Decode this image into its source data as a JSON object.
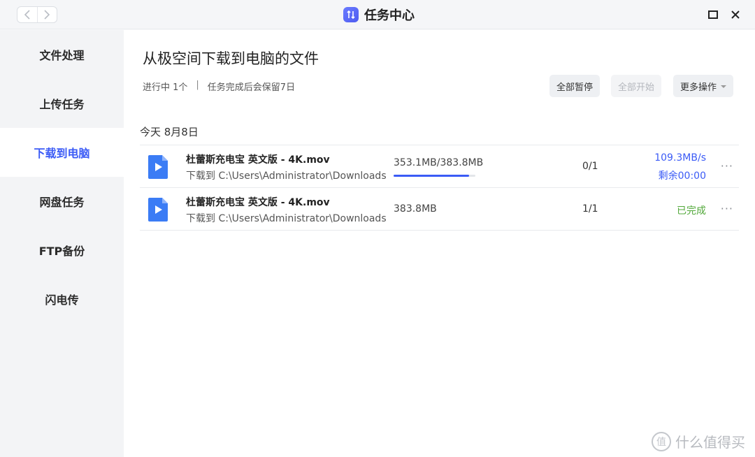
{
  "window": {
    "title": "任务中心",
    "nav_back_icon": "chevron-left-icon",
    "nav_forward_icon": "chevron-right-icon",
    "maximize_icon": "maximize-icon",
    "close_icon": "close-icon"
  },
  "sidebar": {
    "items": [
      {
        "label": "文件处理",
        "active": false
      },
      {
        "label": "上传任务",
        "active": false
      },
      {
        "label": "下载到电脑",
        "active": true
      },
      {
        "label": "网盘任务",
        "active": false
      },
      {
        "label": "FTP备份",
        "active": false
      },
      {
        "label": "闪电传",
        "active": false
      }
    ]
  },
  "main": {
    "title": "从极空间下载到电脑的文件",
    "in_progress": "进行中 1个",
    "separator": "|",
    "retention": "任务完成后会保留7日",
    "buttons": {
      "pause_all": "全部暂停",
      "start_all": "全部开始",
      "more_actions": "更多操作"
    },
    "date_header": "今天 8月8日",
    "tasks": [
      {
        "name": "杜蕾斯充电宝 英文版 - 4K.mov",
        "path": "下载到 C:\\Users\\Administrator\\Downloads",
        "size": "353.1MB/383.8MB",
        "progress": 0.92,
        "count": "0/1",
        "speed": "109.3MB/s",
        "remaining": "剩余00:00",
        "more": "···"
      },
      {
        "name": "杜蕾斯充电宝 英文版 - 4K.mov",
        "path": "下载到 C:\\Users\\Administrator\\Downloads",
        "size": "383.8MB",
        "count": "1/1",
        "status": "已完成",
        "more": "···"
      }
    ]
  },
  "watermark": {
    "badge": "值",
    "text": "什么值得买"
  },
  "colors": {
    "accent": "#3b5bf6",
    "done": "#52a83a"
  }
}
